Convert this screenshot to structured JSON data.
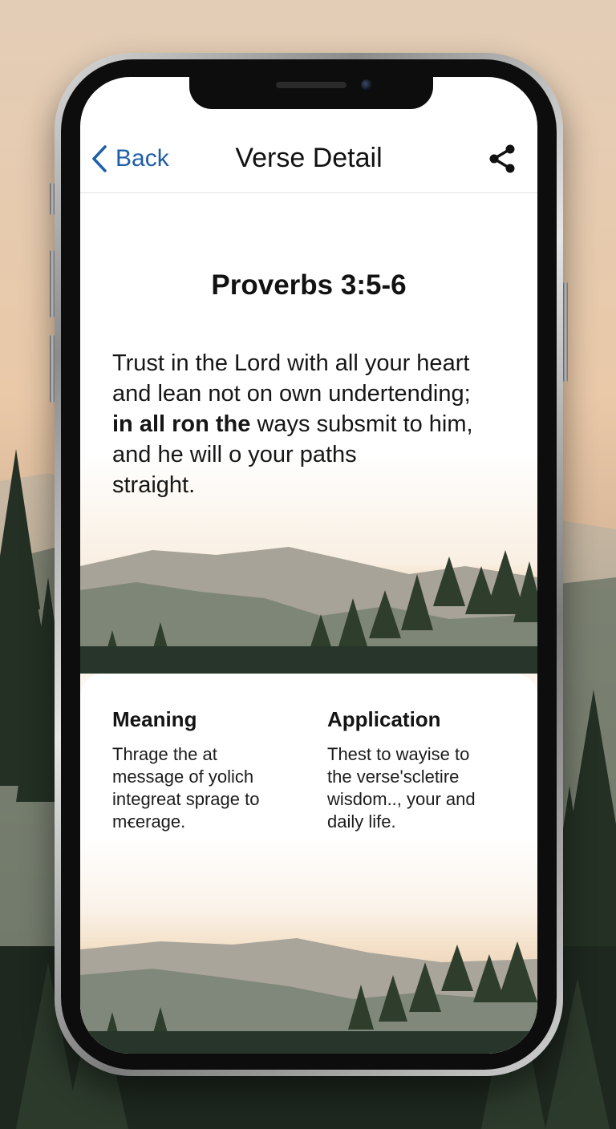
{
  "nav": {
    "back_label": "Back",
    "title": "Verse Detail"
  },
  "icons": {
    "back": "chevron-left-icon",
    "share": "share-icon"
  },
  "colors": {
    "accent": "#1f5ea8",
    "text": "#121212",
    "background": "#ffffff"
  },
  "verse": {
    "reference": "Proverbs 3:5-6",
    "line1": "Trust in the Lord with all your heart",
    "line2": "and lean not on own undertending;",
    "line3_bold": "in all ron the",
    "line3_rest": " ways subsmit to him,",
    "line4": "and he will o your paths",
    "line5": "straight."
  },
  "meaning": {
    "title": "Meaning",
    "line1": "Thrage the at",
    "line2": "message of yolich",
    "line3": "integreat sprage to",
    "line4": "mꞓerage."
  },
  "application": {
    "title": "Application",
    "line1": "Thest to wayise to",
    "line2": "the verse'scletire",
    "line3": "wisdom.., your and",
    "line4": "daily life."
  }
}
